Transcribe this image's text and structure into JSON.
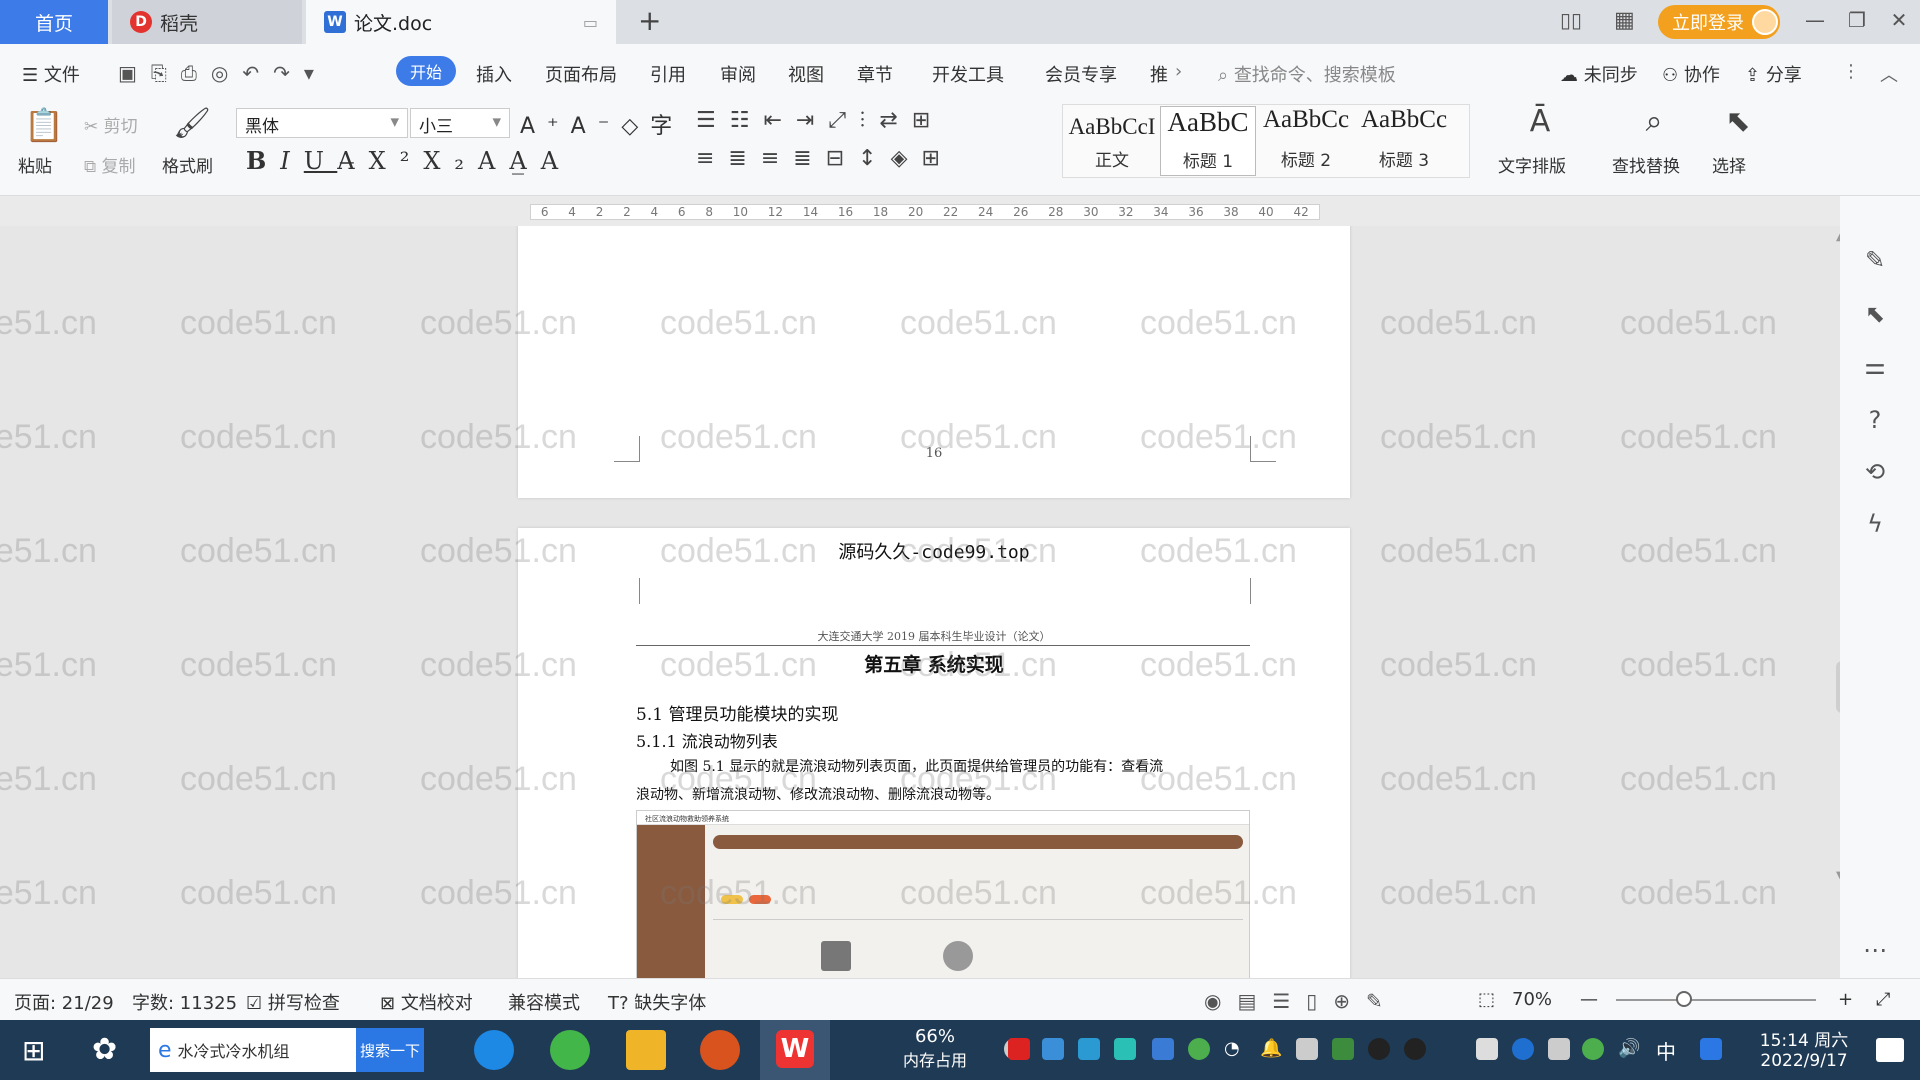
{
  "tabs": {
    "home": "首页",
    "daoke": "稻壳",
    "doc": "论文.doc",
    "login": "立即登录"
  },
  "menu": {
    "file": "文件",
    "items": [
      "开始",
      "插入",
      "页面布局",
      "引用",
      "审阅",
      "视图",
      "章节",
      "开发工具",
      "会员专享",
      "推"
    ],
    "search": "查找命令、搜索模板",
    "unsync": "未同步",
    "collab": "协作",
    "share": "分享"
  },
  "ribbon": {
    "paste": "粘贴",
    "cut": "剪切",
    "copy": "复制",
    "format_painter": "格式刷",
    "font": "黑体",
    "size": "小三",
    "styles": [
      {
        "sample": "AaBbCcI",
        "name": "正文"
      },
      {
        "sample": "AaBbC",
        "name": "标题 1"
      },
      {
        "sample": "AaBbCc",
        "name": "标题 2"
      },
      {
        "sample": "AaBbCc",
        "name": "标题 3"
      }
    ],
    "text_layout": "文字排版",
    "find_replace": "查找替换",
    "select": "选择"
  },
  "ruler": [
    "6",
    "4",
    "2",
    "2",
    "4",
    "6",
    "8",
    "10",
    "12",
    "14",
    "16",
    "18",
    "20",
    "22",
    "24",
    "26",
    "28",
    "30",
    "32",
    "34",
    "36",
    "38",
    "40",
    "42"
  ],
  "document": {
    "page_number": "16",
    "header_source": "源码久久-code99.top",
    "header_line": "大连交通大学 2019 届本科生毕业设计（论文）",
    "chapter": "第五章  系统实现",
    "h2": "5.1  管理员功能模块的实现",
    "h3": "5.1.1  流浪动物列表",
    "para_line1": "如图 5.1 显示的就是流浪动物列表页面，此页面提供给管理员的功能有：查看流",
    "para_line2": "浪动物、新增流浪动物、修改流浪动物、删除流浪动物等。",
    "figure_title": "社区流浪动物救助领养系统"
  },
  "watermark": "code51.cn",
  "status": {
    "page": "页面: 21/29",
    "words": "字数: 11325",
    "spell": "拼写检查",
    "proof": "文档校对",
    "compat": "兼容模式",
    "missing_font": "缺失字体",
    "zoom": "70%"
  },
  "taskbar": {
    "search_text": "水冷式冷水机组",
    "search_btn": "搜索一下",
    "mem_percent": "66%",
    "mem_label": "内存占用",
    "ime": "中",
    "time": "15:14 周六",
    "date": "2022/9/17"
  },
  "colors": {
    "accent": "#3d7be8",
    "login": "#f2a01e",
    "figure_bar": "#8a5a3e"
  }
}
